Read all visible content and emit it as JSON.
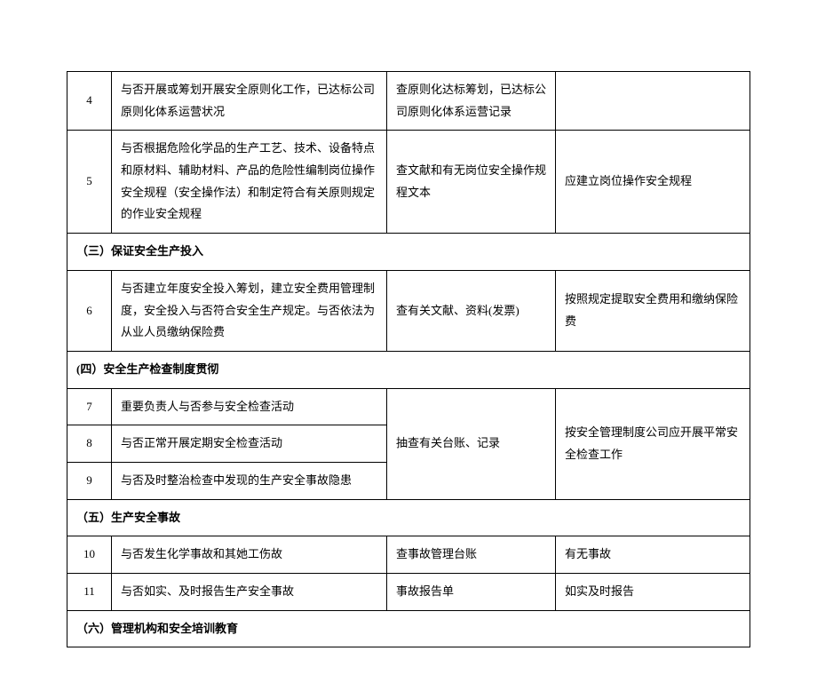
{
  "rows": {
    "r4": {
      "num": "4",
      "desc": "与否开展或筹划开展安全原则化工作，已达标公司原则化体系运营状况",
      "method": "查原则化达标筹划，已达标公司原则化体系运营记录",
      "remark": ""
    },
    "r5": {
      "num": "5",
      "desc": "与否根据危险化学品的生产工艺、技术、设备特点和原材料、辅助材料、产品的危险性编制岗位操作安全规程（安全操作法）和制定符合有关原则规定的作业安全规程",
      "method": "查文献和有无岗位安全操作规程文本",
      "remark": "应建立岗位操作安全规程"
    },
    "s3": {
      "title": "（三）保证安全生产投入"
    },
    "r6": {
      "num": "6",
      "desc": "与否建立年度安全投入筹划，建立安全费用管理制度，安全投入与否符合安全生产规定。与否依法为从业人员缴纳保险费",
      "method": "查有关文献、资料(发票)",
      "remark": "按照规定提取安全费用和缴纳保险费"
    },
    "s4": {
      "title": "(四）安全生产检查制度贯彻"
    },
    "r7": {
      "num": "7",
      "desc": "重要负责人与否参与安全检查活动"
    },
    "r8": {
      "num": "8",
      "desc": "与否正常开展定期安全检查活动"
    },
    "r9": {
      "num": "9",
      "desc": "与否及时整治检查中发现的生产安全事故隐患"
    },
    "g789": {
      "method": "抽查有关台账、记录",
      "remark": "按安全管理制度公司应开展平常安全检查工作"
    },
    "s5": {
      "title": "（五）生产安全事故"
    },
    "r10": {
      "num": "10",
      "desc": "与否发生化学事故和其她工伤故",
      "method": "查事故管理台账",
      "remark": "有无事故"
    },
    "r11": {
      "num": "11",
      "desc": "与否如实、及时报告生产安全事故",
      "method": "事故报告单",
      "remark": "如实及时报告"
    },
    "s6": {
      "title": "（六）管理机构和安全培训教育"
    }
  }
}
